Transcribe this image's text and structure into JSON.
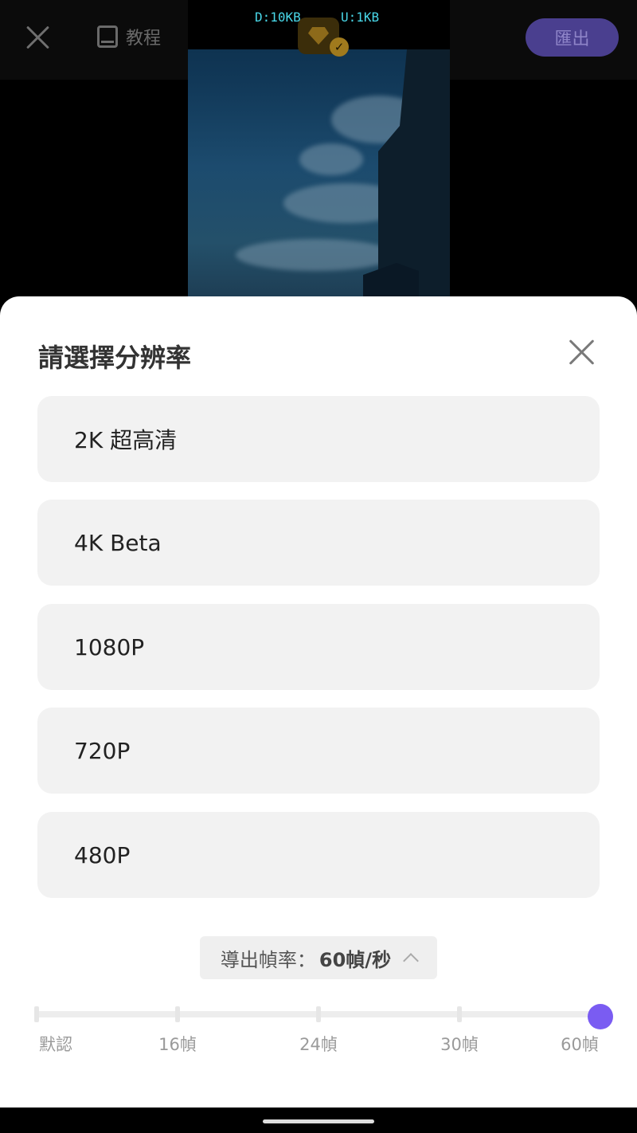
{
  "topbar": {
    "tutorial_label": "教程",
    "export_label": "匯出"
  },
  "preview": {
    "download_speed": "D:10KB",
    "upload_speed": "U:1KB"
  },
  "sheet": {
    "title": "請選擇分辨率",
    "options": [
      {
        "label": "2K 超高清"
      },
      {
        "label": "4K Beta"
      },
      {
        "label": "1080P"
      },
      {
        "label": "720P"
      },
      {
        "label": "480P"
      }
    ],
    "fps": {
      "label": "導出幀率：",
      "value": "60幀/秒",
      "ticks": [
        "默認",
        "16幀",
        "24幀",
        "30幀",
        "60幀"
      ],
      "selected_index": 4
    }
  },
  "colors": {
    "accent": "#7a5cf2",
    "export_button_bg": "#4a3f8f",
    "speed_text": "#49d7e8"
  }
}
